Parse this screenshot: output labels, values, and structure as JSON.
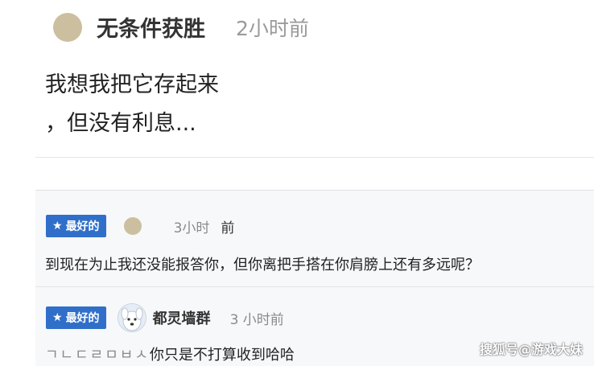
{
  "post": {
    "username": "无条件获胜",
    "time": "2小时前",
    "body_line1": "我想我把它存起来",
    "body_line2": "，但没有利息..."
  },
  "comments": [
    {
      "badge": "最好的",
      "time": "3小时",
      "time_suffix": "前",
      "text": "到现在为止我还没能报答你，但你离把手搭在你肩膀上还有多远呢？"
    },
    {
      "badge": "最好的",
      "username": "都灵墙群",
      "time": "3 小时前",
      "text_prefix": "ㄱㄴㄷㄹㅁㅂㅅ",
      "text": "你只是不打算收到哈哈"
    }
  ],
  "watermark": "搜狐号@游戏大妹",
  "colors": {
    "badge_bg": "#2f6fc9",
    "avatar_dot": "#cbbf9f",
    "comments_bg": "#f7f8fa"
  },
  "icons": {
    "badge_icon": "star-icon"
  }
}
